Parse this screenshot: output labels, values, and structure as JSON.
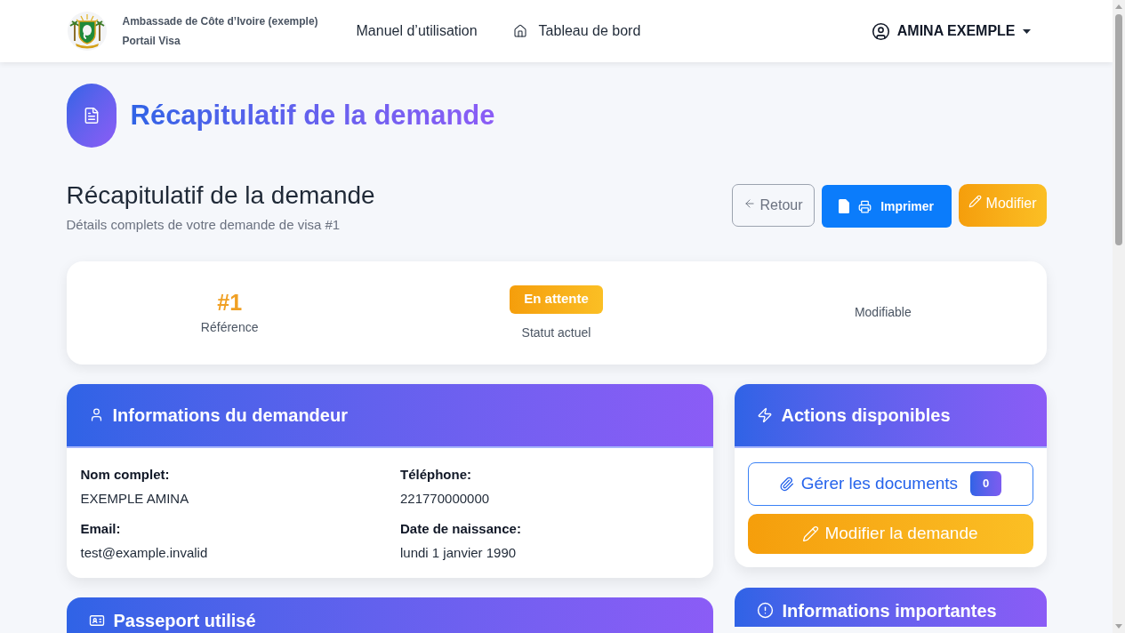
{
  "navbar": {
    "brand": {
      "name": "Ambassade de Côte d’Ivoire (exemple)",
      "subtitle": "Portail Visa"
    },
    "links": [
      {
        "kind": "plain",
        "label": "Manuel d’utilisation"
      },
      {
        "kind": "home",
        "label": "Tableau de bord"
      }
    ],
    "user": {
      "name": "AMINA EXEMPLE"
    }
  },
  "page_header": {
    "title": "Récapitulatif de la demande"
  },
  "summary": {
    "title": "Récapitulatif de la demande",
    "subtitle": "Détails complets de votre demande de visa #1",
    "buttons": [
      {
        "kind": "back",
        "label": "Retour"
      },
      {
        "kind": "print",
        "label": "Imprimer"
      },
      {
        "kind": "edit",
        "label": "Modifier"
      }
    ]
  },
  "status_card": {
    "items": [
      {
        "kind": "number",
        "value": "#1",
        "label": "Référence"
      },
      {
        "kind": "badge",
        "value": "En attente",
        "label": "Statut actuel"
      },
      {
        "kind": "text",
        "label": "Modifiable"
      }
    ]
  },
  "applicant_card": {
    "title": "Informations du demandeur",
    "fields": [
      {
        "label": "Nom complet:",
        "value": "EXEMPLE AMINA"
      },
      {
        "label": "Téléphone:",
        "value": "221770000000"
      },
      {
        "label": "Email:",
        "value": "test@example.invalid"
      },
      {
        "label": "Date de naissance:",
        "value": "lundi 1 janvier 1990"
      }
    ]
  },
  "actions_card": {
    "title": "Actions disponibles",
    "actions": [
      {
        "kind": "documents",
        "label": "Gérer les documents",
        "count": "0"
      },
      {
        "kind": "edit",
        "label": "Modifier la demande"
      }
    ]
  },
  "passport_card": {
    "title": "Passeport utilisé"
  },
  "info_card": {
    "title": "Informations importantes"
  }
}
